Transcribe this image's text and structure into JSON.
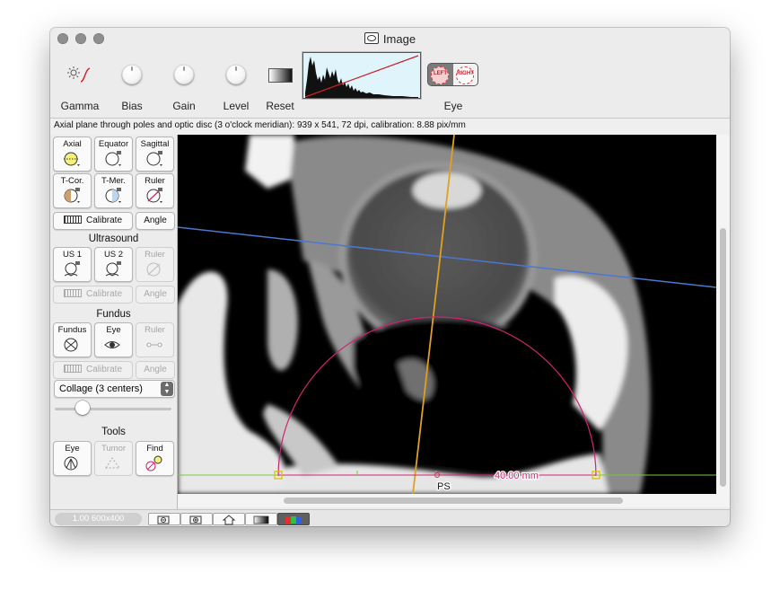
{
  "window": {
    "title": "Image"
  },
  "toolbar": {
    "gamma_label": "Gamma",
    "bias_label": "Bias",
    "gain_label": "Gain",
    "level_label": "Level",
    "reset_label": "Reset",
    "eye_label": "Eye",
    "eye_left": "LEFT",
    "eye_right": "RIGHT"
  },
  "info": {
    "text": "Axial plane through poles and optic disc (3 o'clock meridian): 939 x 541, 72 dpi, calibration: 8.88 pix/mm"
  },
  "sidebar": {
    "planes": [
      {
        "label": "Axial",
        "enabled": true
      },
      {
        "label": "Equator",
        "enabled": true
      },
      {
        "label": "Sagittal",
        "enabled": true
      },
      {
        "label": "T-Cor.",
        "enabled": true
      },
      {
        "label": "T-Mer.",
        "enabled": true
      },
      {
        "label": "Ruler",
        "enabled": true
      }
    ],
    "calibrate_label": "Calibrate",
    "angle_label": "Angle",
    "ultrasound": {
      "heading": "Ultrasound",
      "items": [
        {
          "label": "US 1",
          "enabled": true
        },
        {
          "label": "US 2",
          "enabled": true
        },
        {
          "label": "Ruler",
          "enabled": false
        }
      ],
      "calibrate_label": "Calibrate",
      "angle_label": "Angle"
    },
    "fundus": {
      "heading": "Fundus",
      "items": [
        {
          "label": "Fundus",
          "enabled": true
        },
        {
          "label": "Eye",
          "enabled": true
        },
        {
          "label": "Ruler",
          "enabled": false
        }
      ],
      "calibrate_label": "Calibrate",
      "angle_label": "Angle"
    },
    "collage": {
      "value": "Collage (3 centers)"
    },
    "slider": {
      "value": 0.2
    },
    "tools": {
      "heading": "Tools",
      "items": [
        {
          "label": "Eye",
          "enabled": true
        },
        {
          "label": "Tumor",
          "enabled": false
        },
        {
          "label": "Find",
          "enabled": true
        }
      ]
    }
  },
  "viewer": {
    "measure_label": "40.00 mm",
    "point_label": "PS"
  },
  "statusbar": {
    "zoom": "1.00 600x400"
  },
  "colors": {
    "blue_line": "#4a78d0",
    "orange_line": "#e0a020",
    "magenta_arc": "#d0246e",
    "green_line": "#7ac83c"
  }
}
